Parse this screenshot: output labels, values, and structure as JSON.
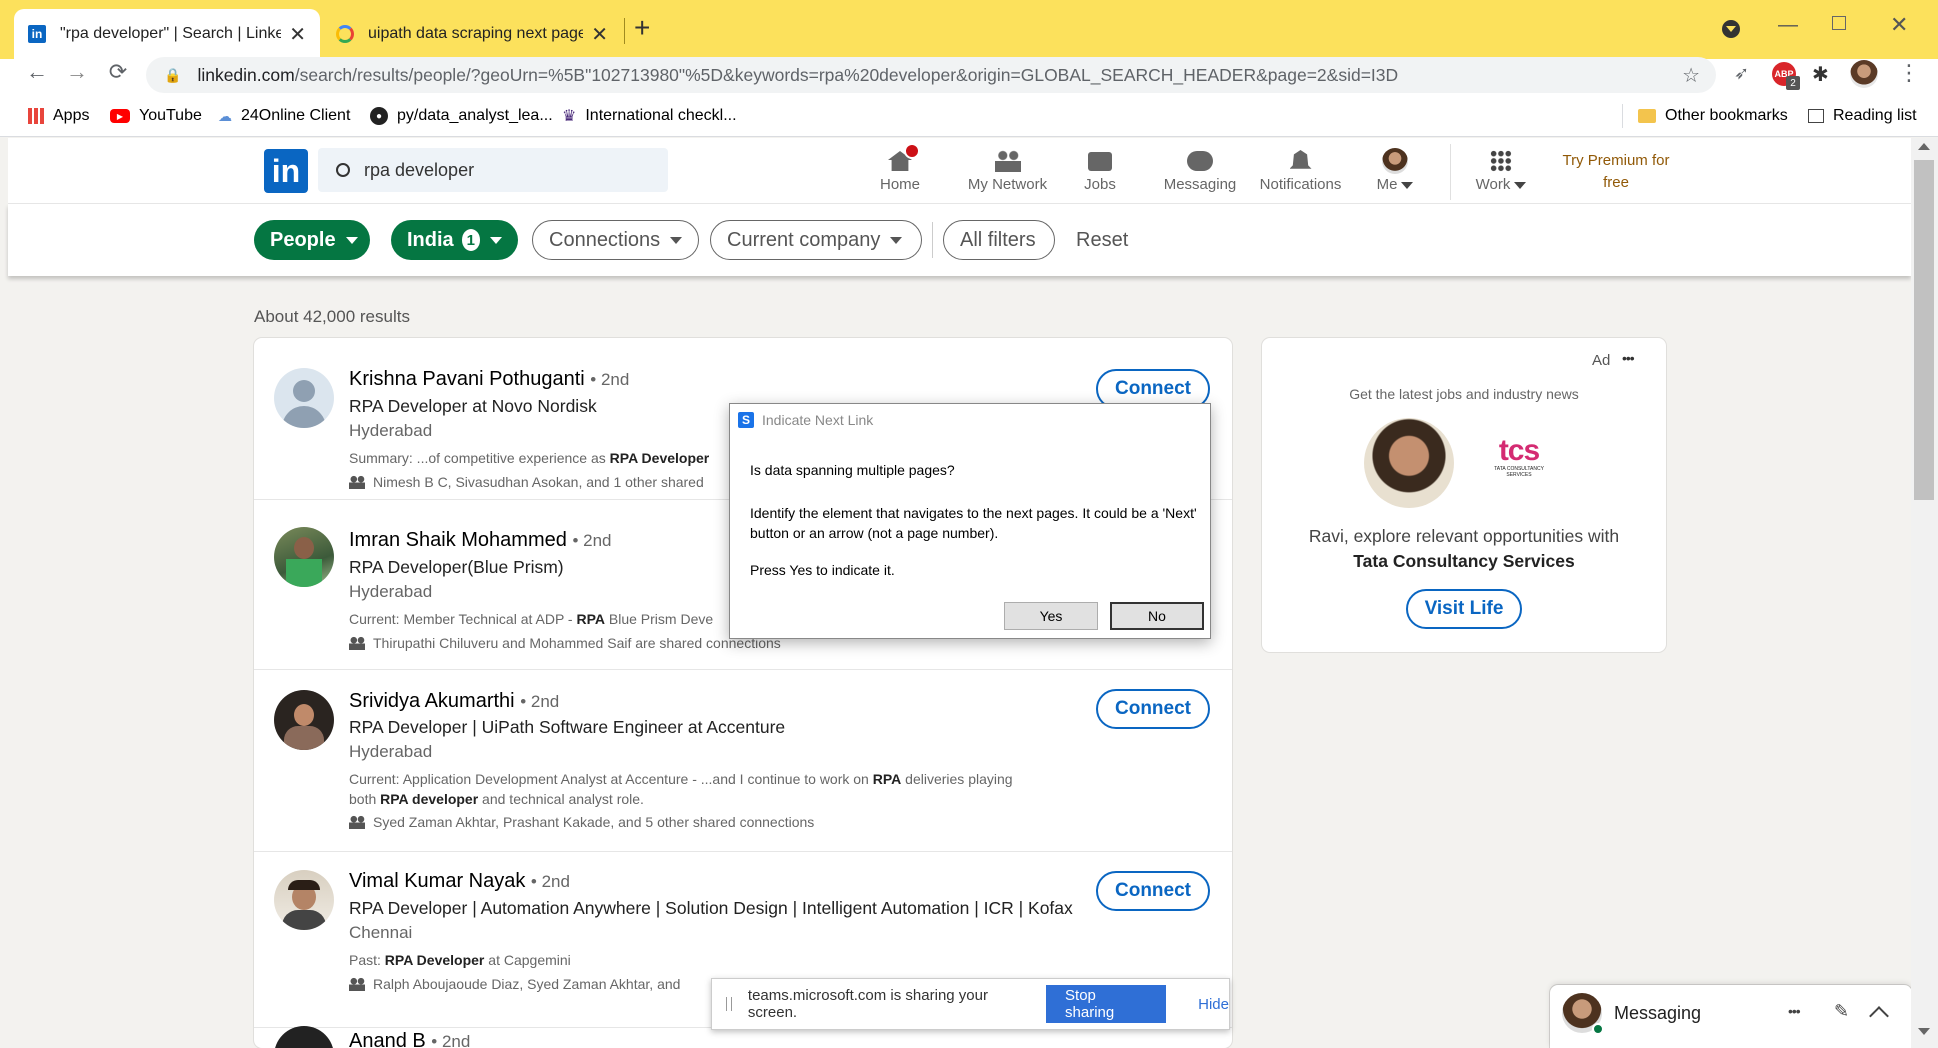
{
  "browser": {
    "tabs": [
      {
        "title": "\"rpa developer\" | Search | LinkedIn",
        "active": true
      },
      {
        "title": "uipath data scraping next page navigation",
        "active": false
      }
    ],
    "url_host": "linkedin.com",
    "url_rest": "/search/results/people/?geoUrn=%5B\"102713980\"%5D&keywords=rpa%20developer&origin=GLOBAL_SEARCH_HEADER&page=2&sid=I3D",
    "bookmarks": [
      "Apps",
      "YouTube",
      "24Online Client",
      "py/data_analyst_lea...",
      "International checkl..."
    ],
    "other_bookmarks": "Other bookmarks",
    "reading_list": "Reading list",
    "abp_count": "2"
  },
  "linkedin": {
    "logo": "in",
    "search_value": "rpa developer",
    "nav": {
      "home": "Home",
      "network": "My Network",
      "jobs": "Jobs",
      "messaging": "Messaging",
      "notifications": "Notifications",
      "me": "Me",
      "work": "Work",
      "premium": "Try Premium for free"
    },
    "filters": {
      "people": "People",
      "india": "India",
      "india_count": "1",
      "connections": "Connections",
      "current_company": "Current company",
      "all_filters": "All filters",
      "reset": "Reset"
    },
    "results_count": "About 42,000 results",
    "connect_label": "Connect",
    "results": [
      {
        "name": "Krishna Pavani Pothuganti",
        "degree": "• 2nd",
        "headline": "RPA Developer at Novo Nordisk",
        "location": "Hyderabad",
        "summary_pre": "Summary: ...of competitive experience as ",
        "summary_bold": "RPA Developer",
        "shared": "Nimesh B C, Sivasudhan Asokan, and 1 other shared"
      },
      {
        "name": "Imran Shaik Mohammed",
        "degree": "• 2nd",
        "headline": "RPA Developer(Blue Prism)",
        "location": "Hyderabad",
        "summary_pre": "Current: Member Technical at ADP - ",
        "summary_bold": "RPA",
        "summary_post": " Blue Prism Deve",
        "shared": "Thirupathi Chiluveru and Mohammed Saif are shared connections"
      },
      {
        "name": "Srividya Akumarthi",
        "degree": "• 2nd",
        "headline": "RPA Developer | UiPath Software Engineer at Accenture",
        "location": "Hyderabad",
        "summary_pre": "Current: Application Development Analyst at Accenture - ...and I continue to work on ",
        "summary_bold": "RPA",
        "summary_post": " deliveries playing",
        "summary2_pre": "both ",
        "summary2_bold": "RPA developer",
        "summary2_post": " and technical analyst role.",
        "shared": "Syed Zaman Akhtar, Prashant Kakade, and 5 other shared connections"
      },
      {
        "name": "Vimal Kumar Nayak",
        "degree": "• 2nd",
        "headline": "RPA Developer | Automation Anywhere | Solution Design | Intelligent Automation | ICR | Kofax",
        "location": "Chennai",
        "summary_pre": "Past: ",
        "summary_bold": "RPA Developer",
        "summary_post": " at Capgemini",
        "shared": "Ralph Aboujaoude Diaz, Syed Zaman Akhtar, and"
      },
      {
        "name": "Anand B",
        "degree": "• 2nd"
      }
    ],
    "ad": {
      "label": "Ad",
      "more": "•••",
      "tagline": "Get the latest jobs and industry news",
      "company_logo_text": "tcs",
      "company_logo_sub": "TATA CONSULTANCY SERVICES",
      "line1": "Ravi, explore relevant opportunities with",
      "line2": "Tata Consultancy Services",
      "cta": "Visit Life"
    },
    "messaging": {
      "label": "Messaging",
      "more": "•••"
    }
  },
  "dialog": {
    "title": "Indicate Next Link",
    "question": "Is data spanning multiple pages?",
    "body": "Identify the element that navigates to the next pages. It could be a 'Next' button or an arrow (not a page number).",
    "press": "Press Yes to indicate it.",
    "yes": "Yes",
    "no": "No"
  },
  "share_bar": {
    "text": "teams.microsoft.com is sharing your screen.",
    "stop": "Stop sharing",
    "hide": "Hide"
  },
  "colors": {
    "chrome_tabbar": "#fce15c",
    "linkedin_blue": "#0a66c2",
    "linkedin_green": "#057642",
    "notification_red": "#cc1016"
  }
}
